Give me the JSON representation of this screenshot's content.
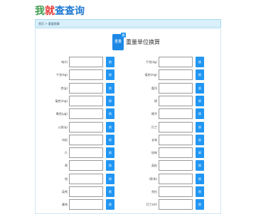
{
  "logo": {
    "chars": [
      "我",
      "就",
      "查",
      "查",
      "询"
    ],
    "colors": [
      "#3a9a4a",
      "#e53935",
      "#1f7ad1",
      "#1f7ad1",
      "#1f7ad1"
    ]
  },
  "breadcrumb": {
    "text": "首页 > 重量换算"
  },
  "app_icon": {
    "badge": "换",
    "label": "重量"
  },
  "page_title": "重量单位换算",
  "convert_label": "换",
  "left_rows": [
    {
      "label": "吨(t)"
    },
    {
      "label": "千克(kg)"
    },
    {
      "label": "克(g)"
    },
    {
      "label": "毫克(mg)"
    },
    {
      "label": "微克(μg)"
    },
    {
      "label": "公担(q)"
    },
    {
      "label": "市担"
    },
    {
      "label": "斤"
    },
    {
      "label": "两"
    },
    {
      "label": "钱"
    },
    {
      "label": "英吨"
    },
    {
      "label": "美吨"
    }
  ],
  "right_rows": [
    {
      "label": "千克(kg)"
    },
    {
      "label": "毫克(mg)"
    },
    {
      "label": "盎司"
    },
    {
      "label": "磅"
    },
    {
      "label": "格令"
    },
    {
      "label": "打兰"
    },
    {
      "label": "长吨"
    },
    {
      "label": "短吨"
    },
    {
      "label": "英担"
    },
    {
      "label": "磅(lb)"
    },
    {
      "label": "克拉"
    },
    {
      "label": "打兰(dr)"
    }
  ]
}
